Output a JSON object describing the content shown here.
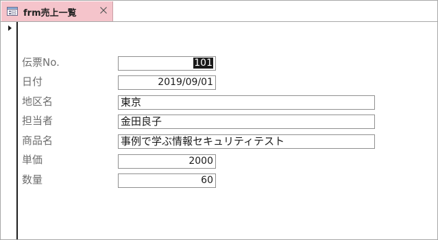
{
  "tab": {
    "title": "frm売上一覧",
    "icon": "form-icon",
    "close_icon": "close-icon"
  },
  "record_selector": {
    "icon": "current-record-arrow-icon"
  },
  "form": {
    "fields": {
      "slip_no": {
        "label": "伝票No.",
        "value": "101"
      },
      "date": {
        "label": "日付",
        "value": "2019/09/01"
      },
      "region": {
        "label": "地区名",
        "value": "東京"
      },
      "staff": {
        "label": "担当者",
        "value": "金田良子"
      },
      "product": {
        "label": "商品名",
        "value": "事例で学ぶ情報セキュリティテスト"
      },
      "unit_price": {
        "label": "単価",
        "value": "2000"
      },
      "quantity": {
        "label": "数量",
        "value": "60"
      }
    }
  },
  "colors": {
    "tab_background": "#f5c4cb",
    "label_text": "#6e6e6e",
    "field_border": "#8e8e8e",
    "selection": "#1a1a1a"
  }
}
